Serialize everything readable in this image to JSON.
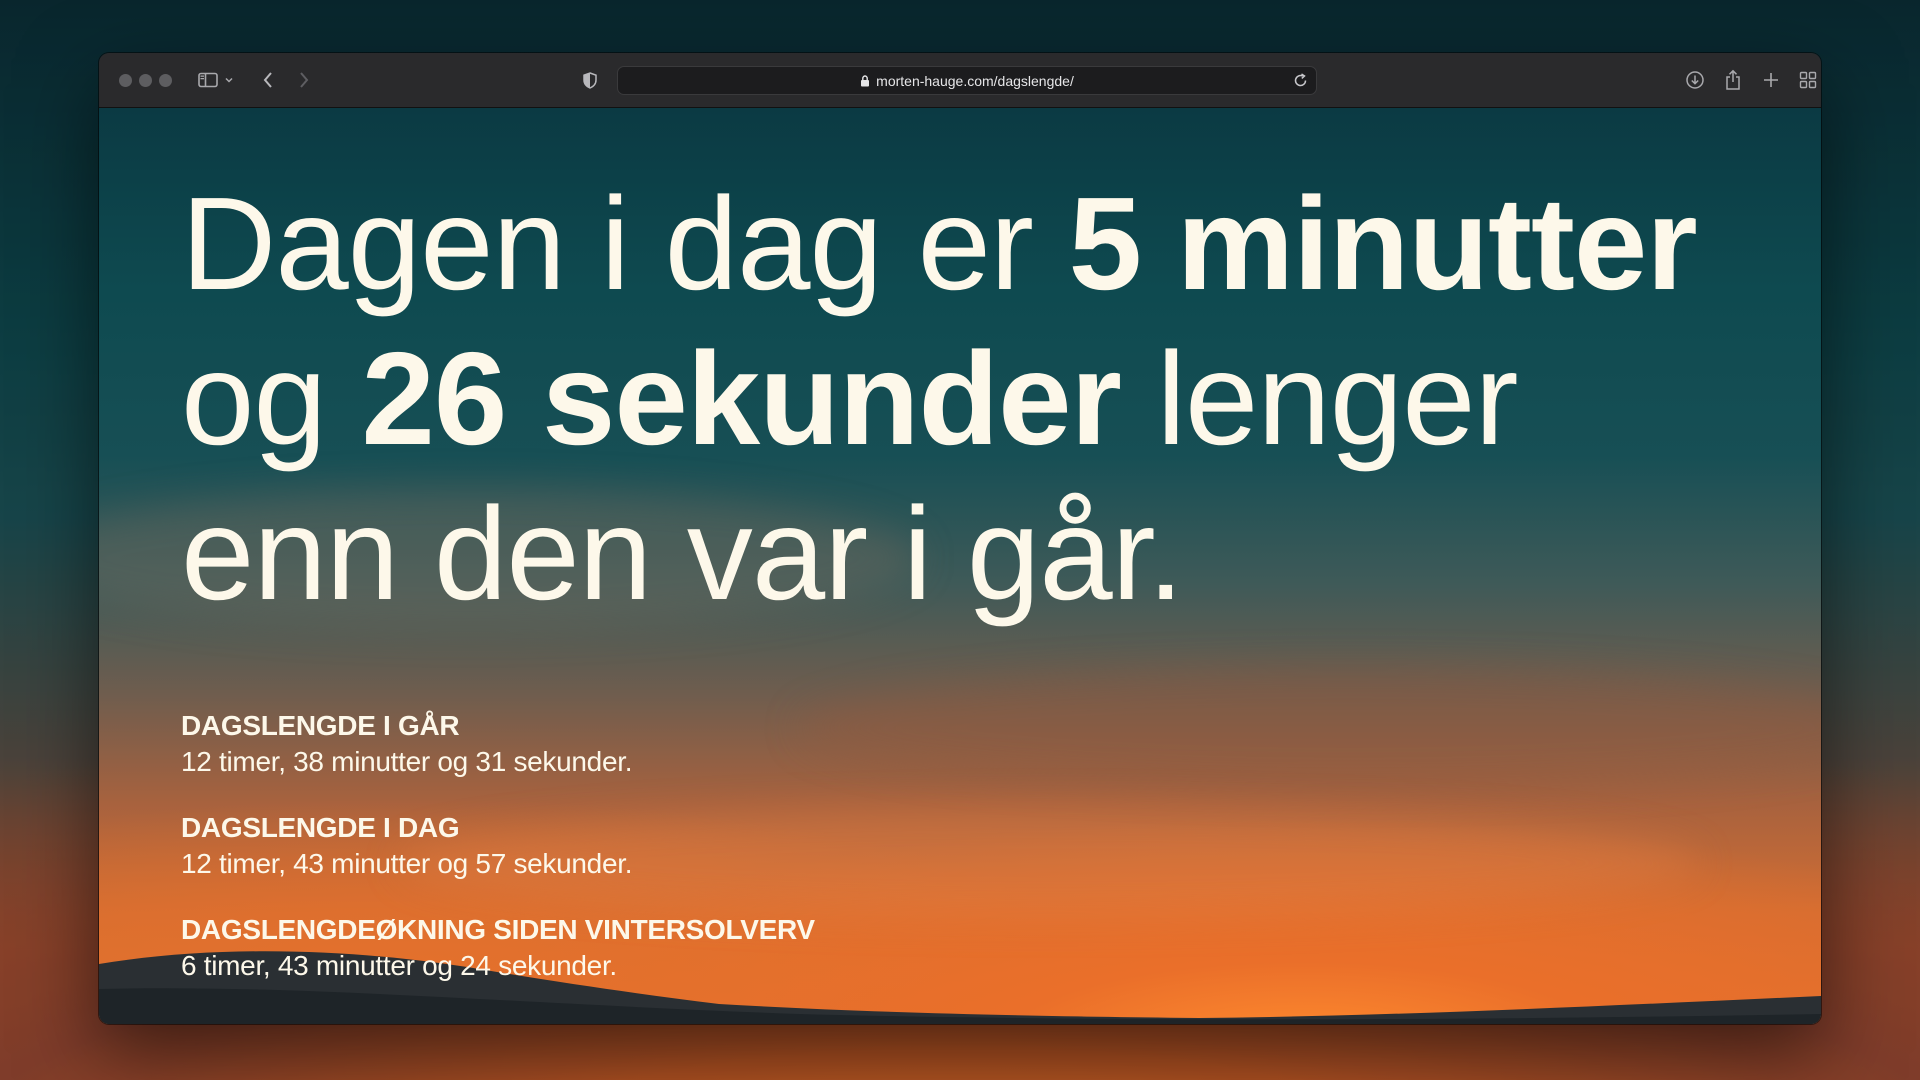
{
  "browser": {
    "url": "morten-hauge.com/dagslengde/",
    "icons": {
      "sidebar": "sidebar-icon",
      "back": "chevron-left-icon",
      "forward": "chevron-right-icon",
      "shield": "shield-icon",
      "lock": "lock-icon",
      "reload": "reload-icon",
      "downloads": "download-icon",
      "share": "share-icon",
      "new_tab": "plus-icon",
      "tab_overview": "grid-icon"
    }
  },
  "page": {
    "headline": {
      "prefix": "Dagen i dag er ",
      "minutes": "5 minutter",
      "middle": " og ",
      "seconds": "26 sekunder",
      "suffix": " lenger enn den var i går."
    },
    "stats": [
      {
        "label": "DAGSLENGDE I GÅR",
        "value": "12 timer, 38 minutter og 31 sekunder."
      },
      {
        "label": "DAGSLENGDE I DAG",
        "value": "12 timer, 43 minutter og 57 sekunder."
      },
      {
        "label": "DAGSLENGDEØKNING SIDEN VINTERSOLVERV",
        "value": "6 timer, 43 minutter og 24 sekunder."
      }
    ]
  },
  "colors": {
    "toolbar": "#2a2a2c",
    "text": "#fdf8ea",
    "sky_top": "#0b3a43",
    "sunset": "#e0702e"
  }
}
